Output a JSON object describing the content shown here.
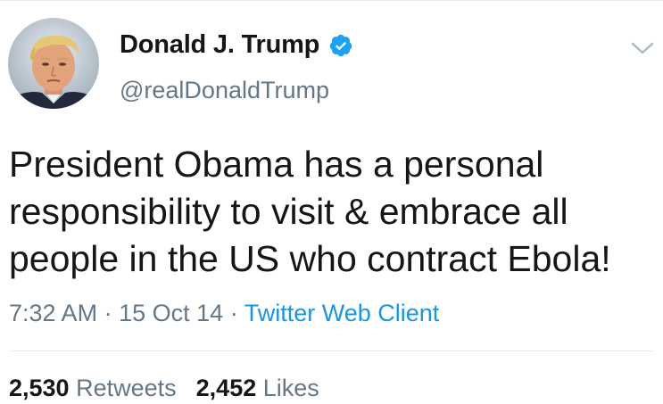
{
  "user": {
    "display_name": "Donald J. Trump",
    "handle": "@realDonaldTrump",
    "verified": true
  },
  "icons": {
    "verified": "verified-badge-icon",
    "menu": "chevron-down-icon"
  },
  "tweet": {
    "text": "President Obama has a personal\nresponsibility to visit & embrace all\npeople in the US who contract Ebola!",
    "time": "7:32 AM",
    "date": "15 Oct 14",
    "separator": "·",
    "client": "Twitter Web Client"
  },
  "stats": {
    "retweets_count": "2,530",
    "retweets_label": "Retweets",
    "likes_count": "2,452",
    "likes_label": "Likes"
  },
  "colors": {
    "text": "#14171a",
    "secondary": "#657786",
    "link": "#1b95e0",
    "verified": "#1da1f2",
    "divider": "#e6ecf0"
  }
}
